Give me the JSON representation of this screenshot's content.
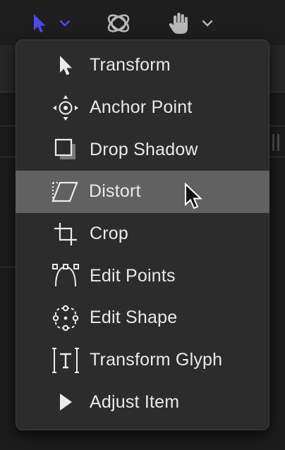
{
  "toolbar": {
    "tools": [
      {
        "icon": "select-arrow-icon",
        "active": true,
        "has_dropdown": true
      },
      {
        "icon": "3d-transform-icon",
        "active": false,
        "has_dropdown": false
      },
      {
        "icon": "pan-hand-icon",
        "active": false,
        "has_dropdown": true
      }
    ],
    "accent_color": "#4b4bf0"
  },
  "menu": {
    "highlighted_index": 3,
    "items": [
      {
        "label": "Transform",
        "icon": "transform-arrow-icon"
      },
      {
        "label": "Anchor Point",
        "icon": "anchor-point-icon"
      },
      {
        "label": "Drop Shadow",
        "icon": "drop-shadow-icon"
      },
      {
        "label": "Distort",
        "icon": "distort-icon"
      },
      {
        "label": "Crop",
        "icon": "crop-icon"
      },
      {
        "label": "Edit Points",
        "icon": "edit-points-icon"
      },
      {
        "label": "Edit Shape",
        "icon": "edit-shape-icon"
      },
      {
        "label": "Transform Glyph",
        "icon": "transform-glyph-icon"
      },
      {
        "label": "Adjust Item",
        "icon": "adjust-item-icon"
      }
    ]
  }
}
